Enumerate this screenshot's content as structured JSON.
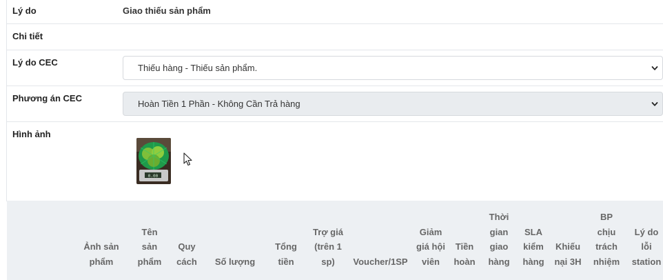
{
  "details": {
    "reason_label": "Lý do",
    "reason_value": "Giao thiếu sản phẩm",
    "detail_label": "Chi tiết",
    "detail_value": "",
    "cec_reason_label": "Lý do CEC",
    "cec_reason_selected": "Thiếu hàng - Thiếu sản phẩm.",
    "cec_plan_label": "Phương án CEC",
    "cec_plan_selected": "Hoàn Tiền 1 Phần - Không Cần Trả hàng",
    "image_label": "Hình ảnh"
  },
  "table": {
    "headers": [
      "Ảnh sản phẩm",
      "Tên sản phẩm",
      "Quy cách",
      "Số lượng",
      "Tổng tiền",
      "Trợ giá (trên 1 sp)",
      "Voucher/1SP",
      "Giảm giá hội viên",
      "Tiền hoàn",
      "Thời gian giao hàng",
      "SLA kiểm hàng",
      "Khiếu nại 3H",
      "BP chịu trách nhiệm",
      "Lý do lỗi station"
    ]
  },
  "colors": {
    "border": "#e3e6ea",
    "table_header_bg": "#edf0f3",
    "disabled_select_bg": "#e9ecef"
  }
}
